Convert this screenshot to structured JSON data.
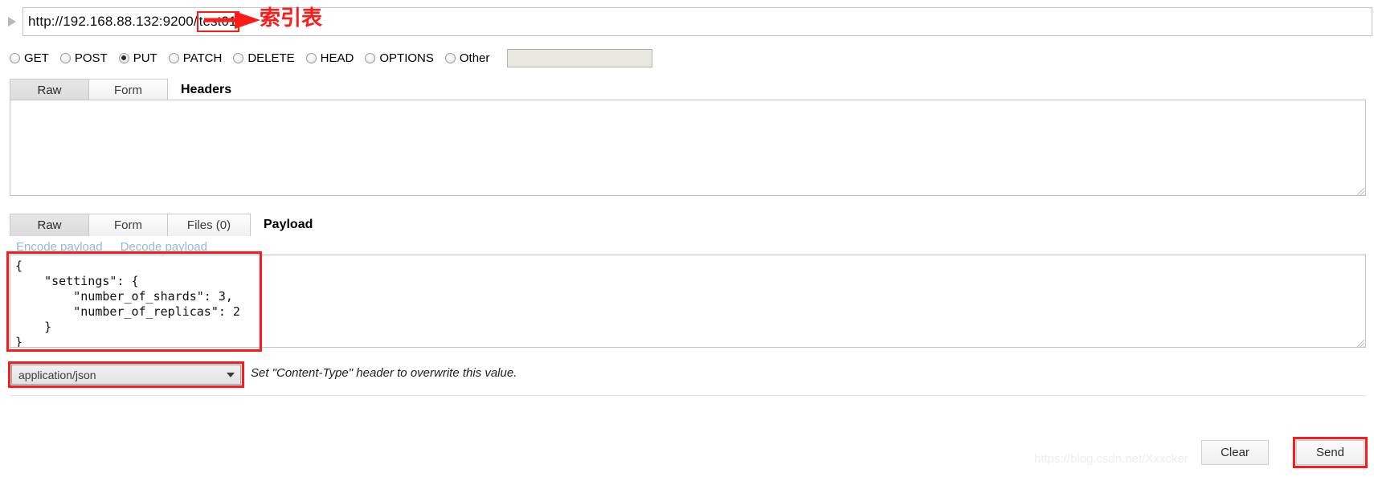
{
  "url_bar": {
    "base": "http://192.168.88.132:9200/",
    "highlighted": "test01",
    "annotation": "索引表"
  },
  "methods": [
    {
      "label": "GET",
      "checked": false
    },
    {
      "label": "POST",
      "checked": false
    },
    {
      "label": "PUT",
      "checked": true
    },
    {
      "label": "PATCH",
      "checked": false
    },
    {
      "label": "DELETE",
      "checked": false
    },
    {
      "label": "HEAD",
      "checked": false
    },
    {
      "label": "OPTIONS",
      "checked": false
    },
    {
      "label": "Other",
      "checked": false
    }
  ],
  "other_method": {
    "value": "",
    "placeholder": ""
  },
  "headers_section": {
    "tabs": [
      {
        "label": "Raw",
        "active": true
      },
      {
        "label": "Form",
        "active": false
      }
    ],
    "title": "Headers",
    "value": ""
  },
  "payload_section": {
    "tabs": [
      {
        "label": "Raw",
        "active": true
      },
      {
        "label": "Form",
        "active": false
      },
      {
        "label": "Files (0)",
        "active": false
      }
    ],
    "title": "Payload",
    "links": [
      "Encode payload",
      "Decode payload"
    ],
    "value": "{\n    \"settings\": {\n        \"number_of_shards\": 3,\n        \"number_of_replicas\": 2\n    }\n}"
  },
  "content_type": {
    "selected": "application/json",
    "options": [
      "application/json"
    ],
    "hint": "Set \"Content-Type\" header to overwrite this value."
  },
  "footer": {
    "clear_label": "Clear",
    "send_label": "Send"
  },
  "watermark": "https://blog.csdn.net/Xxxcker",
  "colors": {
    "annotation_red": "#ff1a1a",
    "link_blue": "#8fb9e0"
  }
}
